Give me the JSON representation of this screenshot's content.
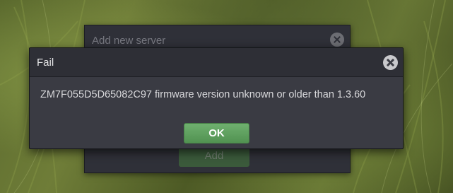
{
  "background_dialog": {
    "title": "Add new server",
    "add_button_label": "Add"
  },
  "dialog": {
    "title": "Fail",
    "message": "ZM7F055D5D65082C97 firmware version unknown or older than 1.3.60",
    "ok_button_label": "OK"
  },
  "colors": {
    "ok_button": "#5fa15f",
    "dialog_background": "#3a3b43",
    "title_bar": "#2e2f36"
  },
  "icons": {
    "close": "close-icon"
  }
}
